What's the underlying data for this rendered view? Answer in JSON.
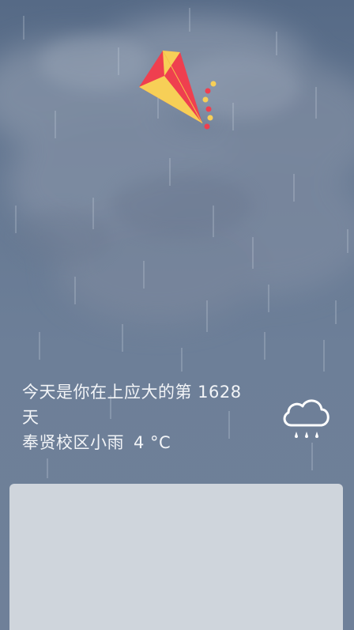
{
  "message": {
    "line1": "今天是你在上应大的第 1628",
    "line2": "天",
    "campus_weather": "奉贤校区小雨",
    "temperature": "4 °C"
  },
  "icons": {
    "weather": "cloud-rain-icon",
    "decoration": "kite-icon"
  },
  "colors": {
    "sky": "#5f7390",
    "panel": "#cfd5dc",
    "kite_red": "#ef3f4f",
    "kite_yellow": "#f7cf57",
    "text": "#f2f4f7"
  }
}
